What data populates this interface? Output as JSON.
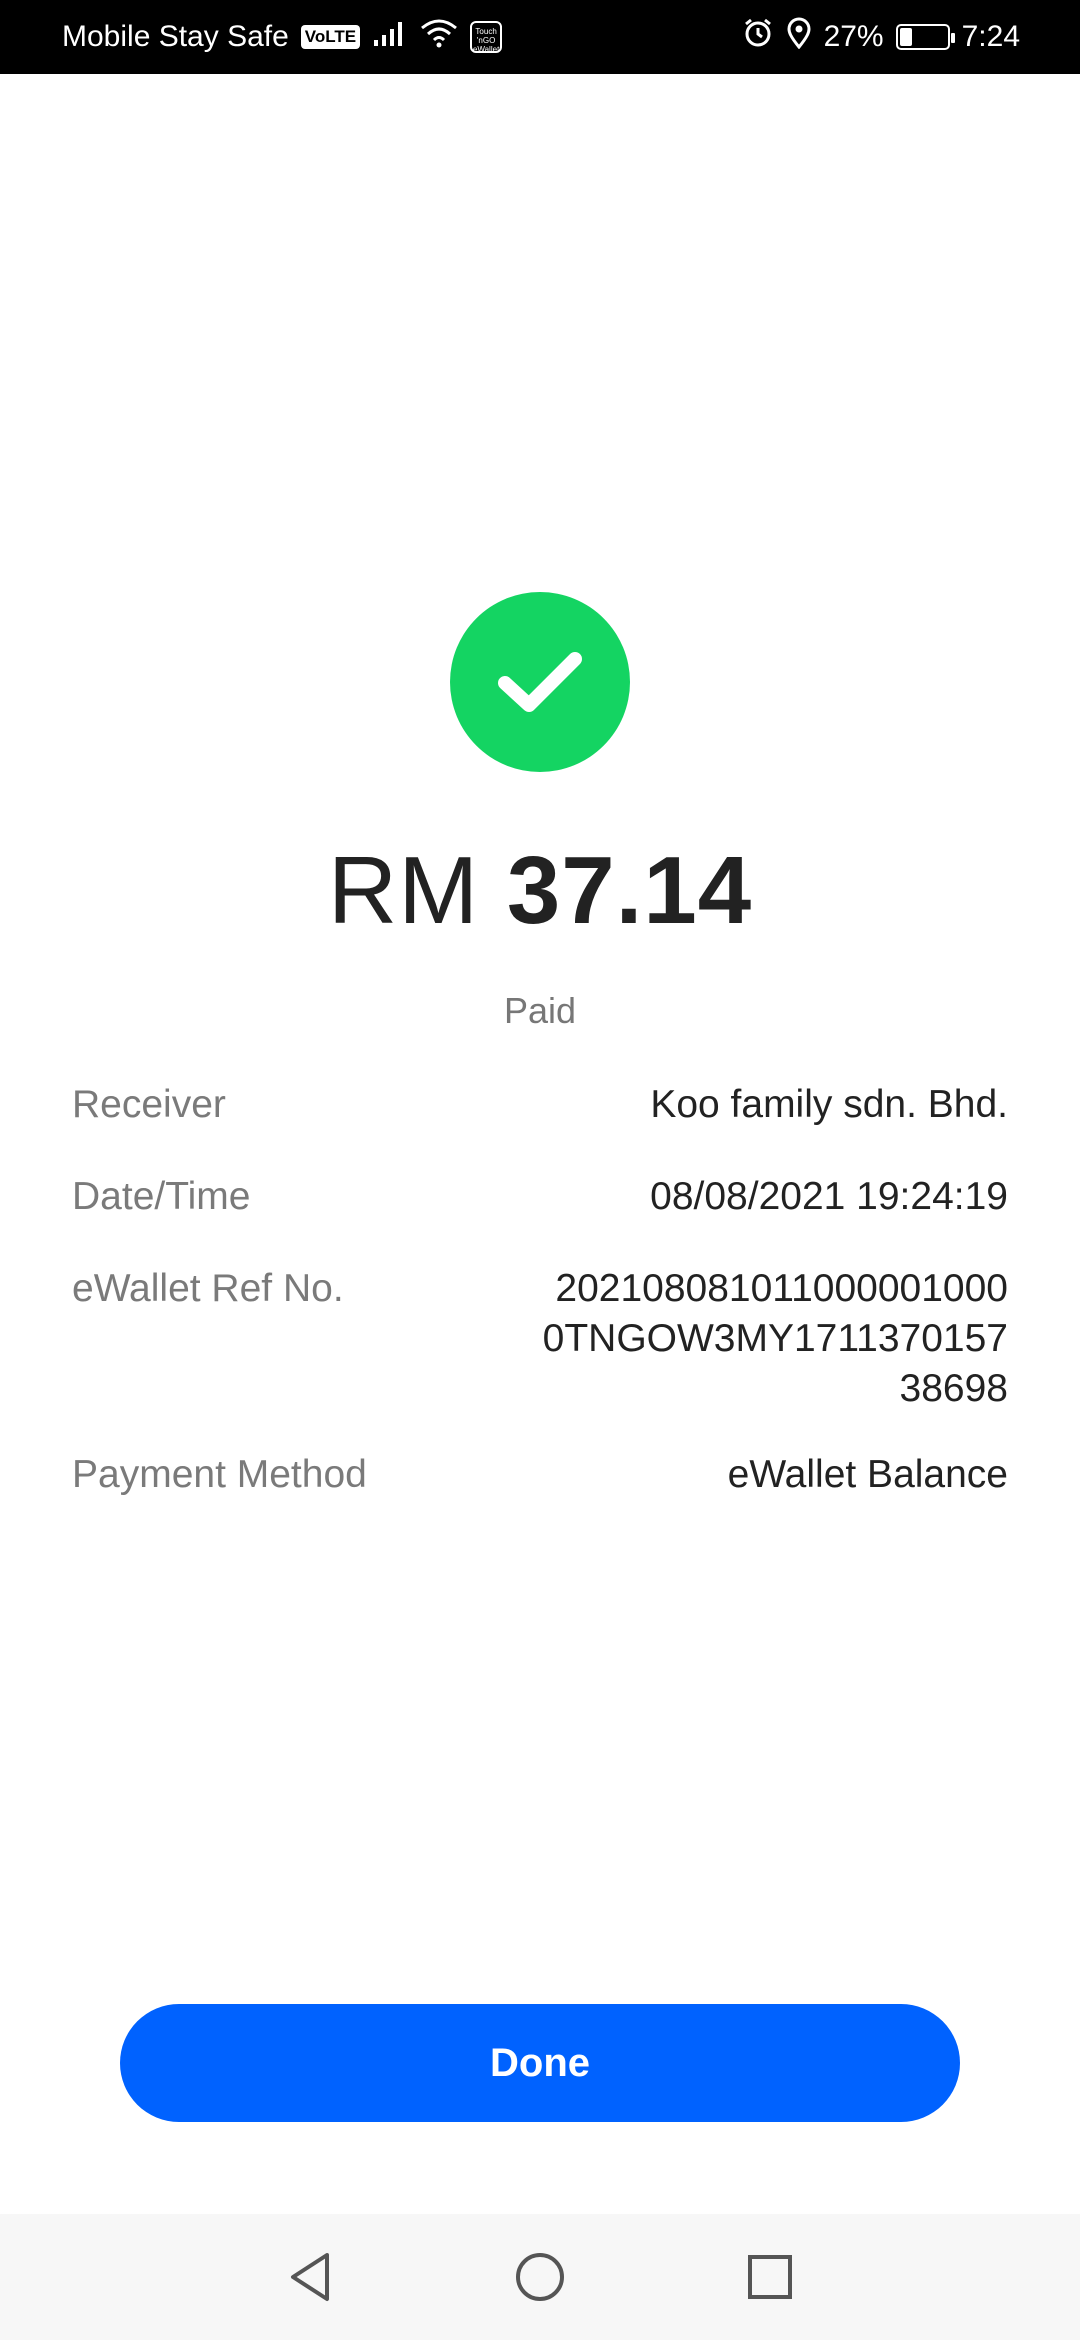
{
  "status_bar": {
    "carrier": "Mobile Stay Safe",
    "volte": "VoLTE",
    "battery_percent": "27%",
    "time": "7:24",
    "battery_level": 0.27,
    "tng_badge_line1": "Touch",
    "tng_badge_line2": "'nGO",
    "tng_badge_line3": "eWallet"
  },
  "receipt": {
    "currency": "RM",
    "amount": "37.14",
    "status": "Paid",
    "success_color": "#14d462",
    "rows": [
      {
        "label": "Receiver",
        "value": "Koo family sdn. Bhd."
      },
      {
        "label": "Date/Time",
        "value": "08/08/2021 19:24:19"
      },
      {
        "label": "eWallet Ref No.",
        "value": "2021080810110000010000TNGOW3MY171137015738698"
      },
      {
        "label": "Payment Method",
        "value": "eWallet Balance"
      }
    ]
  },
  "actions": {
    "done_label": "Done",
    "accent_color": "#0062ff"
  },
  "nav": {
    "back_icon": "triangle-back-icon",
    "home_icon": "circle-home-icon",
    "recent_icon": "square-recents-icon"
  }
}
